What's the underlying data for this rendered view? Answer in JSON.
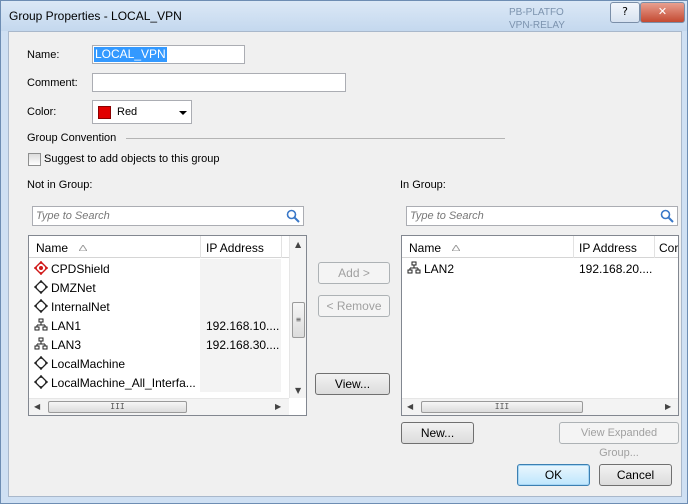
{
  "window": {
    "title": "Group Properties - LOCAL_VPN",
    "help_label": "?",
    "close_label": "✕"
  },
  "background": {
    "items": [
      "PB-PLATFO",
      "VPN-RELAY"
    ]
  },
  "form": {
    "name_label": "Name:",
    "name_value": "LOCAL_VPN",
    "comment_label": "Comment:",
    "comment_value": "",
    "color_label": "Color:",
    "color_value": "Red",
    "color_hex": "#e10000"
  },
  "convention": {
    "heading": "Group Convention",
    "checkbox_label": "Suggest to add objects to this group",
    "checked": false
  },
  "not_in_group": {
    "heading": "Not in Group:",
    "search_placeholder": "Type to Search",
    "columns": [
      "Name",
      "IP Address"
    ],
    "rows": [
      {
        "icon": "gateway-icon",
        "name": "CPDShield",
        "ip": ""
      },
      {
        "icon": "network-object-icon",
        "name": "DMZNet",
        "ip": ""
      },
      {
        "icon": "network-object-icon",
        "name": "InternalNet",
        "ip": ""
      },
      {
        "icon": "network-icon",
        "name": "LAN1",
        "ip": "192.168.10...."
      },
      {
        "icon": "network-icon",
        "name": "LAN3",
        "ip": "192.168.30...."
      },
      {
        "icon": "network-object-icon",
        "name": "LocalMachine",
        "ip": ""
      },
      {
        "icon": "network-object-icon",
        "name": "LocalMachine_All_Interfa...",
        "ip": ""
      }
    ]
  },
  "in_group": {
    "heading": "In Group:",
    "search_placeholder": "Type to Search",
    "columns": [
      "Name",
      "IP Address",
      "Cor"
    ],
    "rows": [
      {
        "icon": "network-icon",
        "name": "LAN2",
        "ip": "192.168.20...."
      }
    ]
  },
  "buttons": {
    "add": "Add  >",
    "remove": "< Remove",
    "view": "View...",
    "new": "New...",
    "view_expanded": "View Expanded Group...",
    "ok": "OK",
    "cancel": "Cancel"
  },
  "scroll_glyph": "III"
}
